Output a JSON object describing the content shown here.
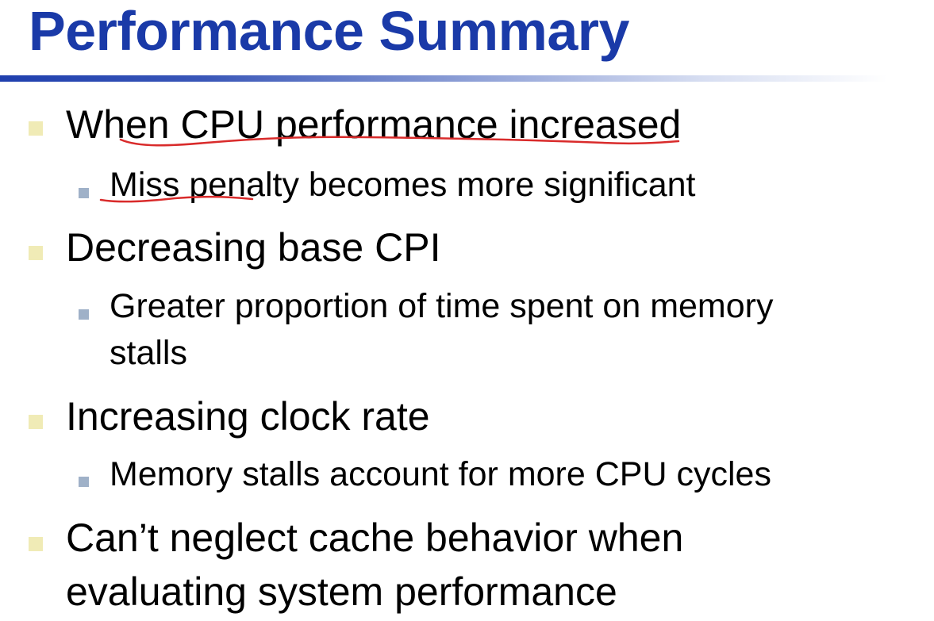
{
  "slide": {
    "title": "Performance Summary",
    "bullets": [
      {
        "text": "When CPU performance increased",
        "sub": [
          "Miss penalty becomes more significant"
        ]
      },
      {
        "text": "Decreasing base CPI",
        "sub": [
          "Greater proportion of time spent on memory",
          "stalls"
        ]
      },
      {
        "text": "Increasing clock rate",
        "sub": [
          "Memory stalls account for more CPU cycles"
        ]
      },
      {
        "text": "Can’t neglect cache behavior when",
        "text_line2": "evaluating system performance"
      }
    ]
  },
  "colors": {
    "title": "#1a3aa8",
    "bullet_level1": "#f0ebb6",
    "bullet_level2": "#9fb1c8",
    "annotation_ink": "#d92b2b"
  }
}
